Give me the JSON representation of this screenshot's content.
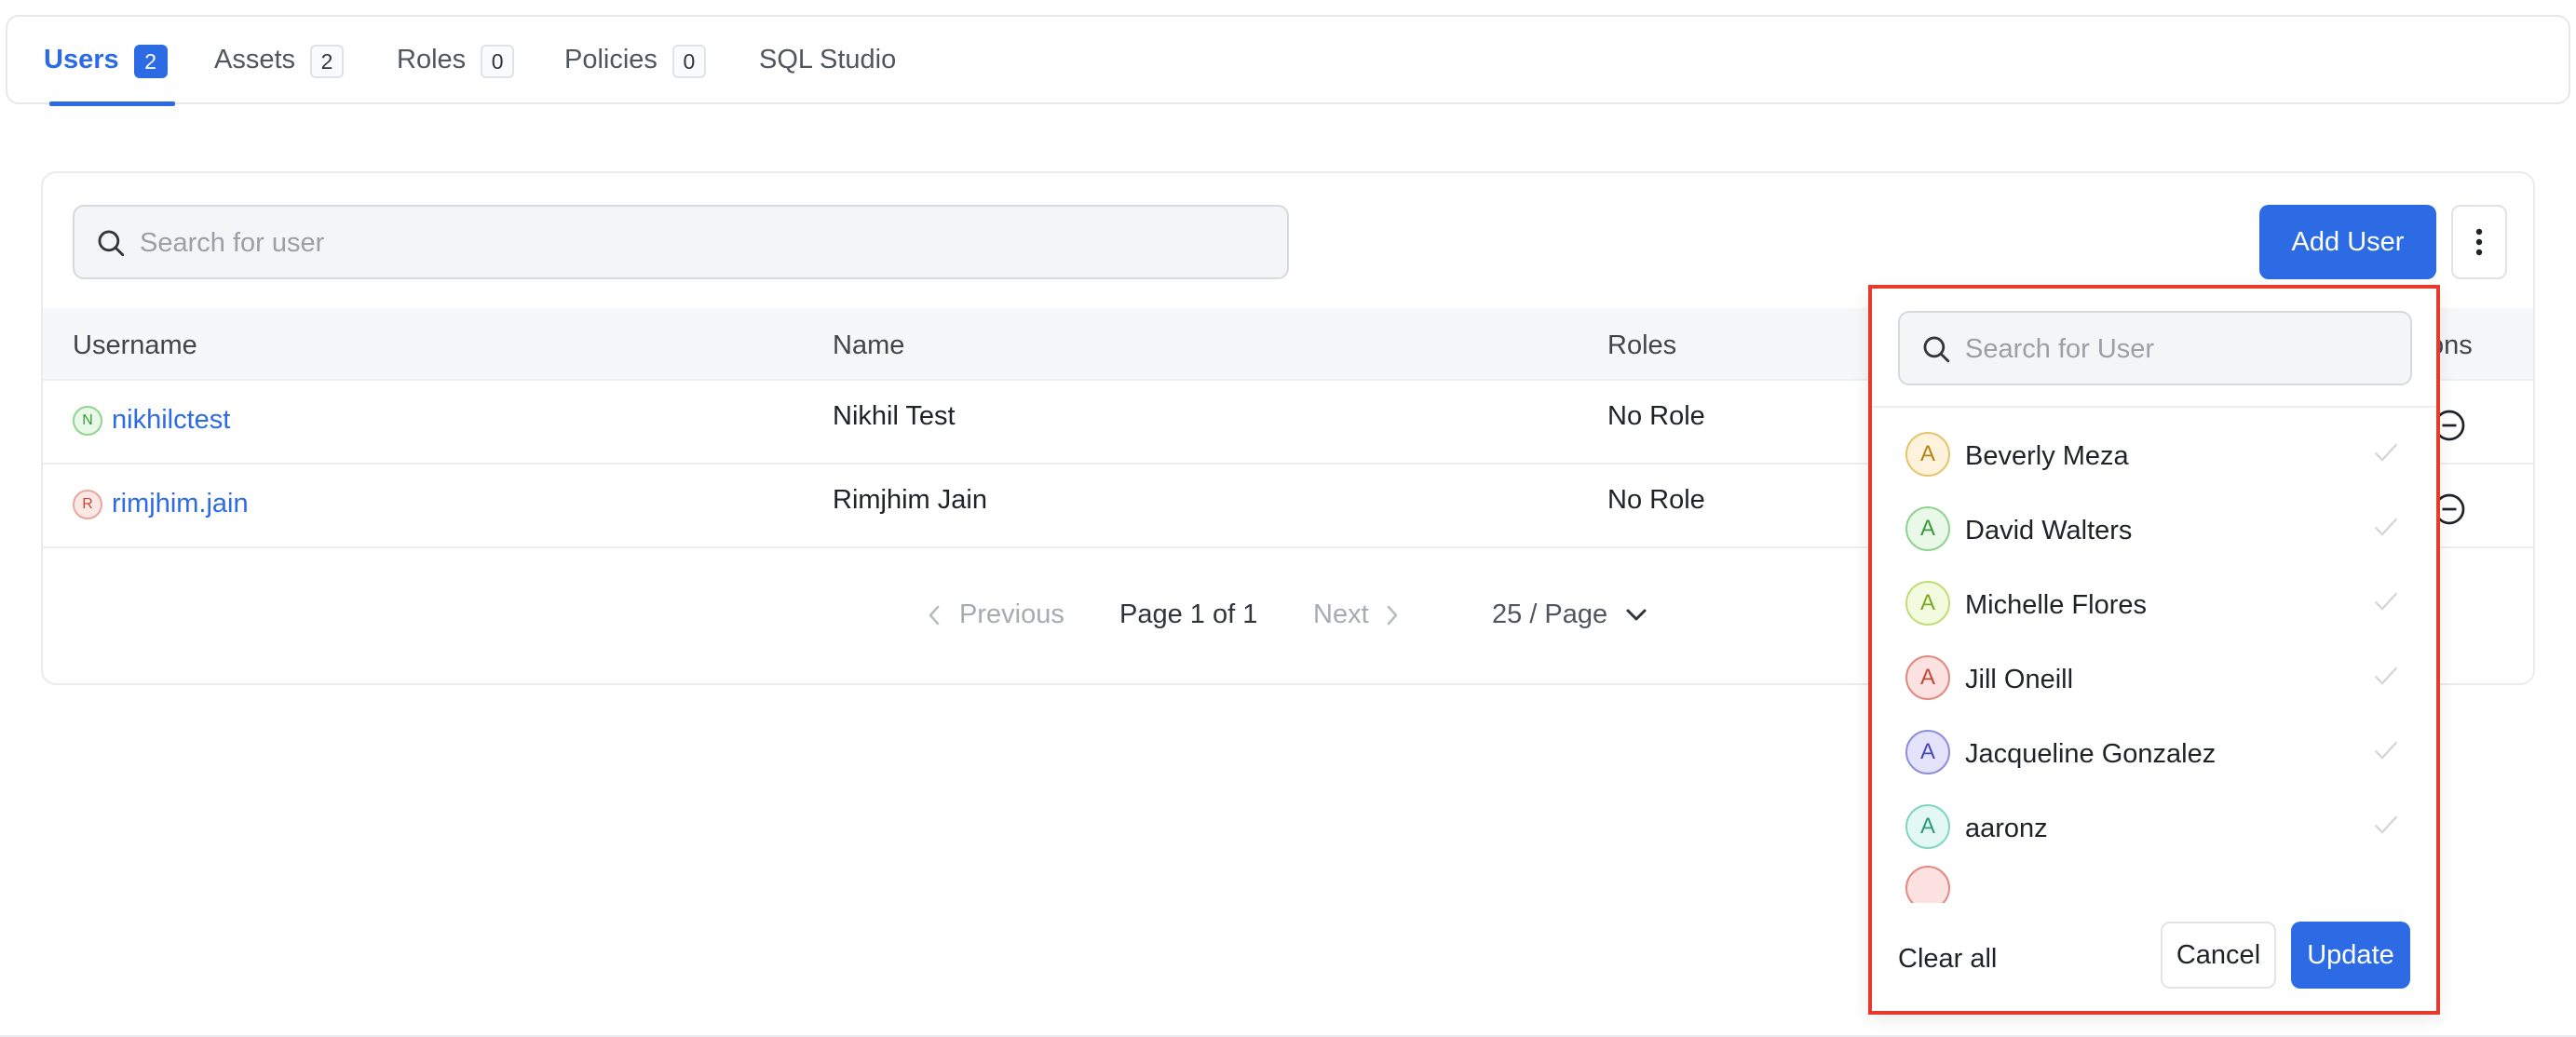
{
  "tabs": [
    {
      "label": "Users",
      "count": "2",
      "active": true
    },
    {
      "label": "Assets",
      "count": "2"
    },
    {
      "label": "Roles",
      "count": "0"
    },
    {
      "label": "Policies",
      "count": "0"
    },
    {
      "label": "SQL Studio"
    }
  ],
  "search": {
    "placeholder": "Search for user",
    "value": ""
  },
  "toolbar": {
    "add_user_label": "Add User"
  },
  "table": {
    "headers": {
      "username": "Username",
      "name": "Name",
      "roles": "Roles",
      "actions": "ons"
    },
    "rows": [
      {
        "initial": "N",
        "username": "nikhilctest",
        "name": "Nikhil Test",
        "roles": "No Role"
      },
      {
        "initial": "R",
        "username": "rimjhim.jain",
        "name": "Rimjhim Jain",
        "roles": "No Role"
      }
    ]
  },
  "pagination": {
    "previous": "Previous",
    "info": "Page 1 of 1",
    "next": "Next",
    "page_size": "25 / Page"
  },
  "user_dropdown": {
    "search_placeholder": "Search for User",
    "items": [
      {
        "initial": "A",
        "name": "Beverly Meza"
      },
      {
        "initial": "A",
        "name": "David Walters"
      },
      {
        "initial": "A",
        "name": "Michelle Flores"
      },
      {
        "initial": "A",
        "name": "Jill Oneill"
      },
      {
        "initial": "A",
        "name": "Jacqueline Gonzalez"
      },
      {
        "initial": "A",
        "name": "aaronz"
      }
    ],
    "clear_label": "Clear all",
    "cancel_label": "Cancel",
    "update_label": "Update"
  },
  "colors": {
    "accent": "#2d6be4",
    "highlight_border": "#e53a2c"
  }
}
